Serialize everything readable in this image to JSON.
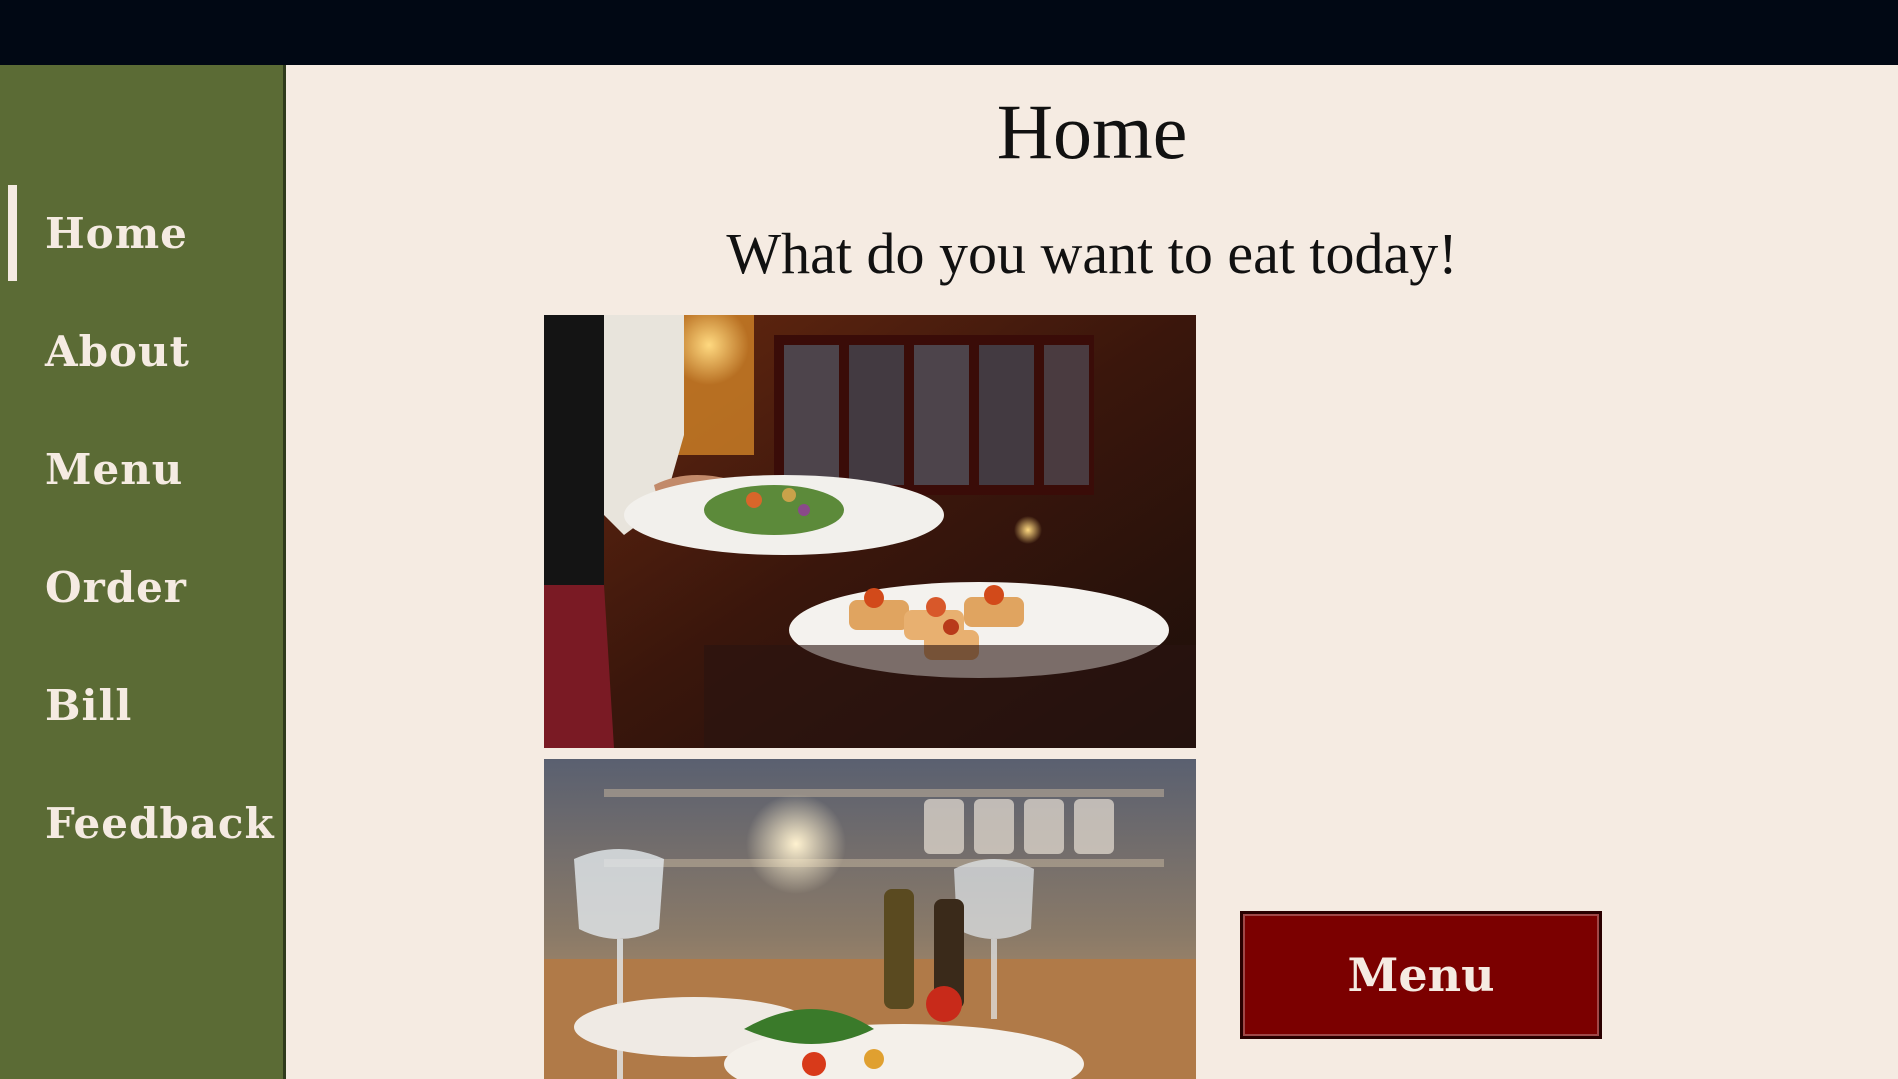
{
  "sidebar": {
    "active": "Home",
    "items": [
      {
        "label": "Home"
      },
      {
        "label": "About"
      },
      {
        "label": "Menu"
      },
      {
        "label": "Order"
      },
      {
        "label": "Bill"
      },
      {
        "label": "Feedback"
      }
    ]
  },
  "main": {
    "title": "Home",
    "subtitle": "What do you want to eat today!",
    "menu_button_label": "Menu"
  },
  "colors": {
    "topbar": "#010814",
    "sidebar": "#5b6b35",
    "background": "#f5ebe2",
    "button": "#7b0000",
    "sidebar_text": "#f5ebe2"
  }
}
